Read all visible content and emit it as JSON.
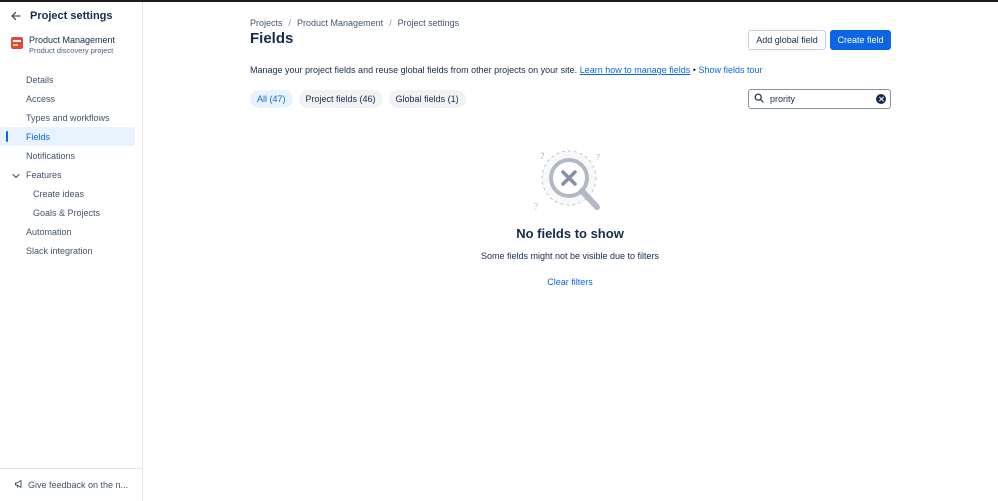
{
  "sidebar": {
    "title": "Project settings",
    "project": {
      "name": "Product Management",
      "subtitle": "Product discovery project"
    },
    "items": [
      {
        "label": "Details"
      },
      {
        "label": "Access"
      },
      {
        "label": "Types and workflows"
      },
      {
        "label": "Fields",
        "active": true
      },
      {
        "label": "Notifications"
      },
      {
        "label": "Features",
        "expanded": true
      },
      {
        "label": "Create ideas"
      },
      {
        "label": "Goals & Projects"
      },
      {
        "label": "Automation"
      },
      {
        "label": "Slack integration"
      }
    ],
    "feedback": "Give feedback on the n..."
  },
  "breadcrumb": [
    "Projects",
    "Product Management",
    "Project settings"
  ],
  "header": {
    "title": "Fields",
    "add_global_label": "Add global field",
    "create_label": "Create field"
  },
  "description": {
    "text": "Manage your project fields and reuse global fields from other projects on your site.",
    "link1": "Learn how to manage fields",
    "bullet": "•",
    "link2": "Show fields tour"
  },
  "filters": [
    {
      "label": "All (47)",
      "active": true
    },
    {
      "label": "Project fields (46)"
    },
    {
      "label": "Global fields (1)"
    }
  ],
  "search": {
    "value": "prority"
  },
  "empty_state": {
    "title": "No fields to show",
    "subtitle": "Some fields might not be visible due to filters",
    "action": "Clear filters"
  },
  "colors": {
    "accent": "#0c66e4",
    "active_bg": "#e9f2ff",
    "text": "#172b4d"
  }
}
